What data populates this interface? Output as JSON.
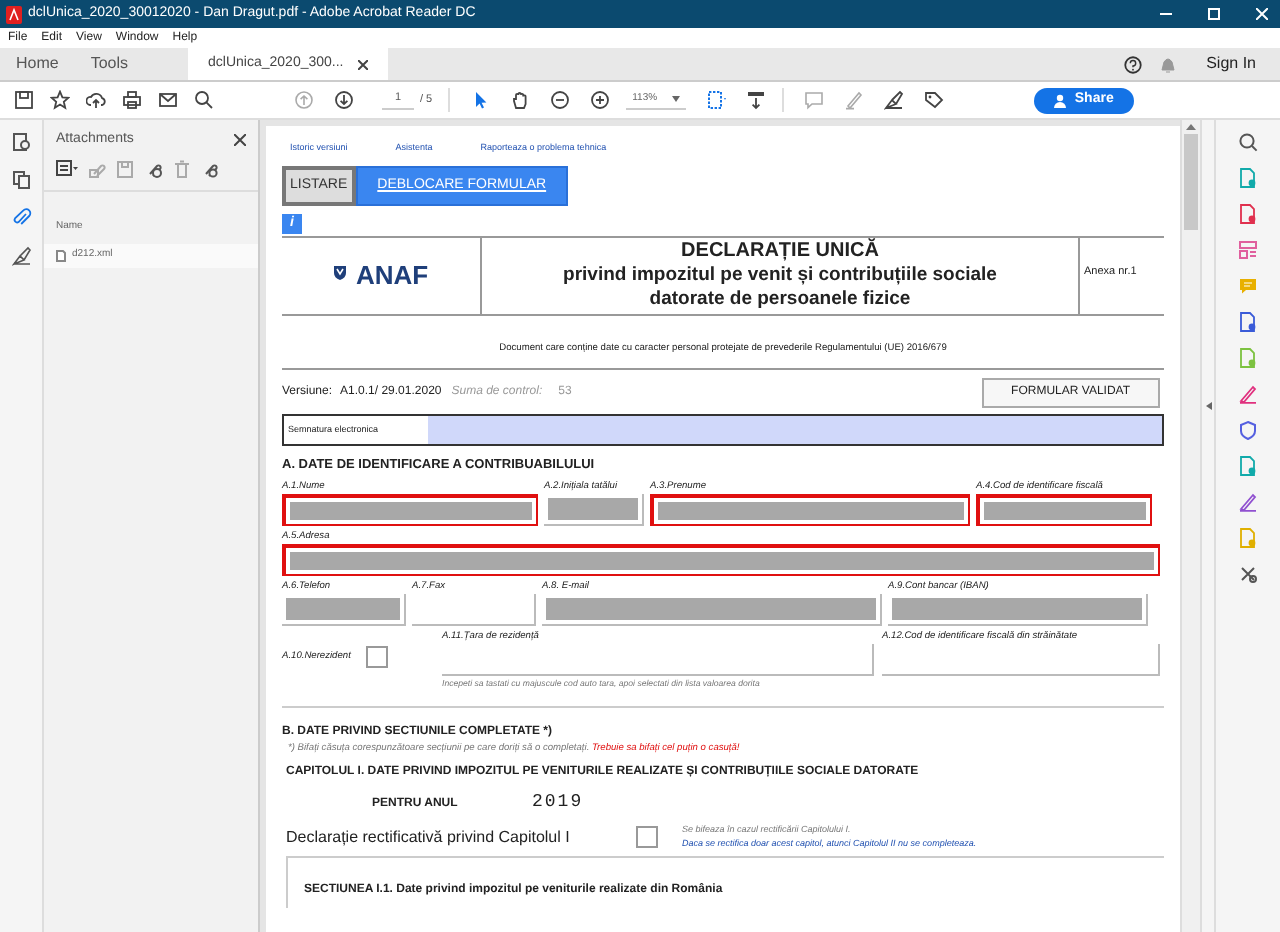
{
  "window": {
    "title": "dclUnica_2020_30012020 - Dan Dragut.pdf - Adobe Acrobat Reader DC"
  },
  "menu": [
    "File",
    "Edit",
    "View",
    "Window",
    "Help"
  ],
  "tabs": [
    {
      "label": "Home",
      "selected": false
    },
    {
      "label": "Tools",
      "selected": false
    },
    {
      "label": "dclUnica_2020_300...",
      "selected": true,
      "closable": true
    }
  ],
  "sign_in": "Sign In",
  "toolbar": {
    "page_current": "1",
    "page_total": "/ 5",
    "zoom": "113%",
    "share": "Share"
  },
  "attachments": {
    "title": "Attachments",
    "column": "Name",
    "files": [
      {
        "name": "d212.xml"
      }
    ]
  },
  "document": {
    "links": [
      "Istoric versiuni",
      "Asistenta",
      "Raporteaza o problema tehnica"
    ],
    "buttons": [
      {
        "label": "LISTARE",
        "kind": "plain"
      },
      {
        "label": "DEBLOCARE FORMULAR",
        "kind": "primary"
      }
    ],
    "info": "i",
    "logo": "ANAF",
    "title_lines": [
      "DECLARAȚIE UNICĂ",
      "privind impozitul pe venit și contribuțiile sociale",
      "datorate de persoanele fizice"
    ],
    "annex": "Anexa nr.1",
    "notice": "Document care conține date cu caracter personal protejate de prevederile Regulamentului (UE) 2016/679",
    "version_label": "Versiune:",
    "version": "A1.0.1/ 29.01.2020",
    "control_label": "Suma de control:",
    "control_value": "53",
    "validated": "FORMULAR VALIDAT",
    "signature_label": "Semnatura electronica",
    "section_a": "A. DATE DE IDENTIFICARE A CONTRIBUABILULUI",
    "field_rows": [
      [
        {
          "label": "A.1.Nume",
          "required": true,
          "filled": true
        },
        {
          "label": "A.2.Inițiala tatălui",
          "required": false,
          "filled": true
        },
        {
          "label": "A.3.Prenume",
          "required": true,
          "filled": true
        },
        {
          "label": "A.4.Cod de identificare fiscală",
          "required": true,
          "filled": true
        }
      ],
      [
        {
          "label": "A.5.Adresa",
          "required": true,
          "filled": true
        }
      ],
      [
        {
          "label": "A.6.Telefon",
          "required": false,
          "filled": true
        },
        {
          "label": "A.7.Fax",
          "required": false,
          "filled": false
        },
        {
          "label": "A.8. E-mail",
          "required": false,
          "filled": true
        },
        {
          "label": "A.9.Cont bancar (IBAN)",
          "required": false,
          "filled": true
        }
      ]
    ],
    "nonresident": {
      "label": "A.10.Nerezident",
      "checked": false
    },
    "residence": {
      "label": "A.11.Țara de rezidență",
      "hint": "Incepeti sa tastati cu majuscule cod auto tara, apoi selectati din lista valoarea dorita"
    },
    "foreign_code": {
      "label": "A.12.Cod de identificare fiscală din străinătate"
    },
    "section_b": "B. DATE PRIVIND SECTIUNILE COMPLETATE *)",
    "section_b_note": "*) Bifați  căsuța corespunzătoare secțiunii pe care doriți să o completați.",
    "section_b_warning": "Trebuie sa bifați cel puțin o casuță!",
    "chapter": "CAPITOLUL I. DATE PRIVIND IMPOZITUL PE VENITURILE REALIZATE ȘI CONTRIBUȚIILE SOCIALE DATORATE",
    "year_label": "PENTRU ANUL",
    "year": "2019",
    "rectification": {
      "label": "Declarație rectificativă privind Capitolul I",
      "checked": false,
      "note": "Se bifeaza în cazul rectificării Capitolului I.",
      "note_blue": "Daca se rectifica doar acest capitol, atunci  Capitolul II  nu se completeaza."
    },
    "subsection": "SECTIUNEA I.1. Date privind impozitul pe veniturile realizate din România"
  }
}
